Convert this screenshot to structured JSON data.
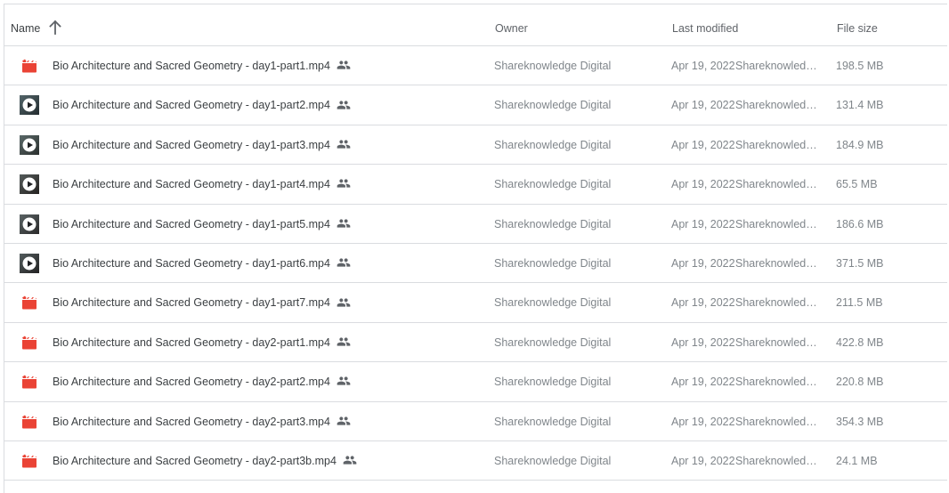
{
  "columns": {
    "name": "Name",
    "owner": "Owner",
    "last_modified": "Last modified",
    "file_size": "File size"
  },
  "sort": {
    "column": "name",
    "direction": "ascending",
    "icon": "arrow-up-icon"
  },
  "colors": {
    "video_icon_red": "#ea4335",
    "text_primary": "#3c4043",
    "text_secondary": "#80868b",
    "divider": "#dadce0"
  },
  "files": [
    {
      "name": "Bio Architecture and Sacred Geometry - day1-part1.mp4",
      "icon": "video-file-icon",
      "shared": true,
      "owner": "Shareknowledge Digital",
      "modified_date": "Apr 19, 2022",
      "modified_by": "Shareknowledge Digital",
      "size": "198.5 MB"
    },
    {
      "name": "Bio Architecture and Sacred Geometry - day1-part2.mp4",
      "icon": "video-thumbnail-icon",
      "shared": true,
      "owner": "Shareknowledge Digital",
      "modified_date": "Apr 19, 2022",
      "modified_by": "Shareknowledge Digital",
      "size": "131.4 MB"
    },
    {
      "name": "Bio Architecture and Sacred Geometry - day1-part3.mp4",
      "icon": "video-thumbnail-icon",
      "shared": true,
      "owner": "Shareknowledge Digital",
      "modified_date": "Apr 19, 2022",
      "modified_by": "Shareknowledge Digital",
      "size": "184.9 MB"
    },
    {
      "name": "Bio Architecture and Sacred Geometry - day1-part4.mp4",
      "icon": "video-thumbnail-icon",
      "shared": true,
      "owner": "Shareknowledge Digital",
      "modified_date": "Apr 19, 2022",
      "modified_by": "Shareknowledge Digital",
      "size": "65.5 MB"
    },
    {
      "name": "Bio Architecture and Sacred Geometry - day1-part5.mp4",
      "icon": "video-thumbnail-icon",
      "shared": true,
      "owner": "Shareknowledge Digital",
      "modified_date": "Apr 19, 2022",
      "modified_by": "Shareknowledge Digital",
      "size": "186.6 MB"
    },
    {
      "name": "Bio Architecture and Sacred Geometry - day1-part6.mp4",
      "icon": "video-thumbnail-icon",
      "shared": true,
      "owner": "Shareknowledge Digital",
      "modified_date": "Apr 19, 2022",
      "modified_by": "Shareknowledge Digital",
      "size": "371.5 MB"
    },
    {
      "name": "Bio Architecture and Sacred Geometry - day1-part7.mp4",
      "icon": "video-file-icon",
      "shared": true,
      "owner": "Shareknowledge Digital",
      "modified_date": "Apr 19, 2022",
      "modified_by": "Shareknowledge Digital",
      "size": "211.5 MB"
    },
    {
      "name": "Bio Architecture and Sacred Geometry - day2-part1.mp4",
      "icon": "video-file-icon",
      "shared": true,
      "owner": "Shareknowledge Digital",
      "modified_date": "Apr 19, 2022",
      "modified_by": "Shareknowledge Digital",
      "size": "422.8 MB"
    },
    {
      "name": "Bio Architecture and Sacred Geometry - day2-part2.mp4",
      "icon": "video-file-icon",
      "shared": true,
      "owner": "Shareknowledge Digital",
      "modified_date": "Apr 19, 2022",
      "modified_by": "Shareknowledge Digital",
      "size": "220.8 MB"
    },
    {
      "name": "Bio Architecture and Sacred Geometry - day2-part3.mp4",
      "icon": "video-file-icon",
      "shared": true,
      "owner": "Shareknowledge Digital",
      "modified_date": "Apr 19, 2022",
      "modified_by": "Shareknowledge Digital",
      "size": "354.3 MB"
    },
    {
      "name": "Bio Architecture and Sacred Geometry - day2-part3b.mp4",
      "icon": "video-file-icon",
      "shared": true,
      "owner": "Shareknowledge Digital",
      "modified_date": "Apr 19, 2022",
      "modified_by": "Shareknowledge Digital",
      "size": "24.1 MB"
    }
  ]
}
